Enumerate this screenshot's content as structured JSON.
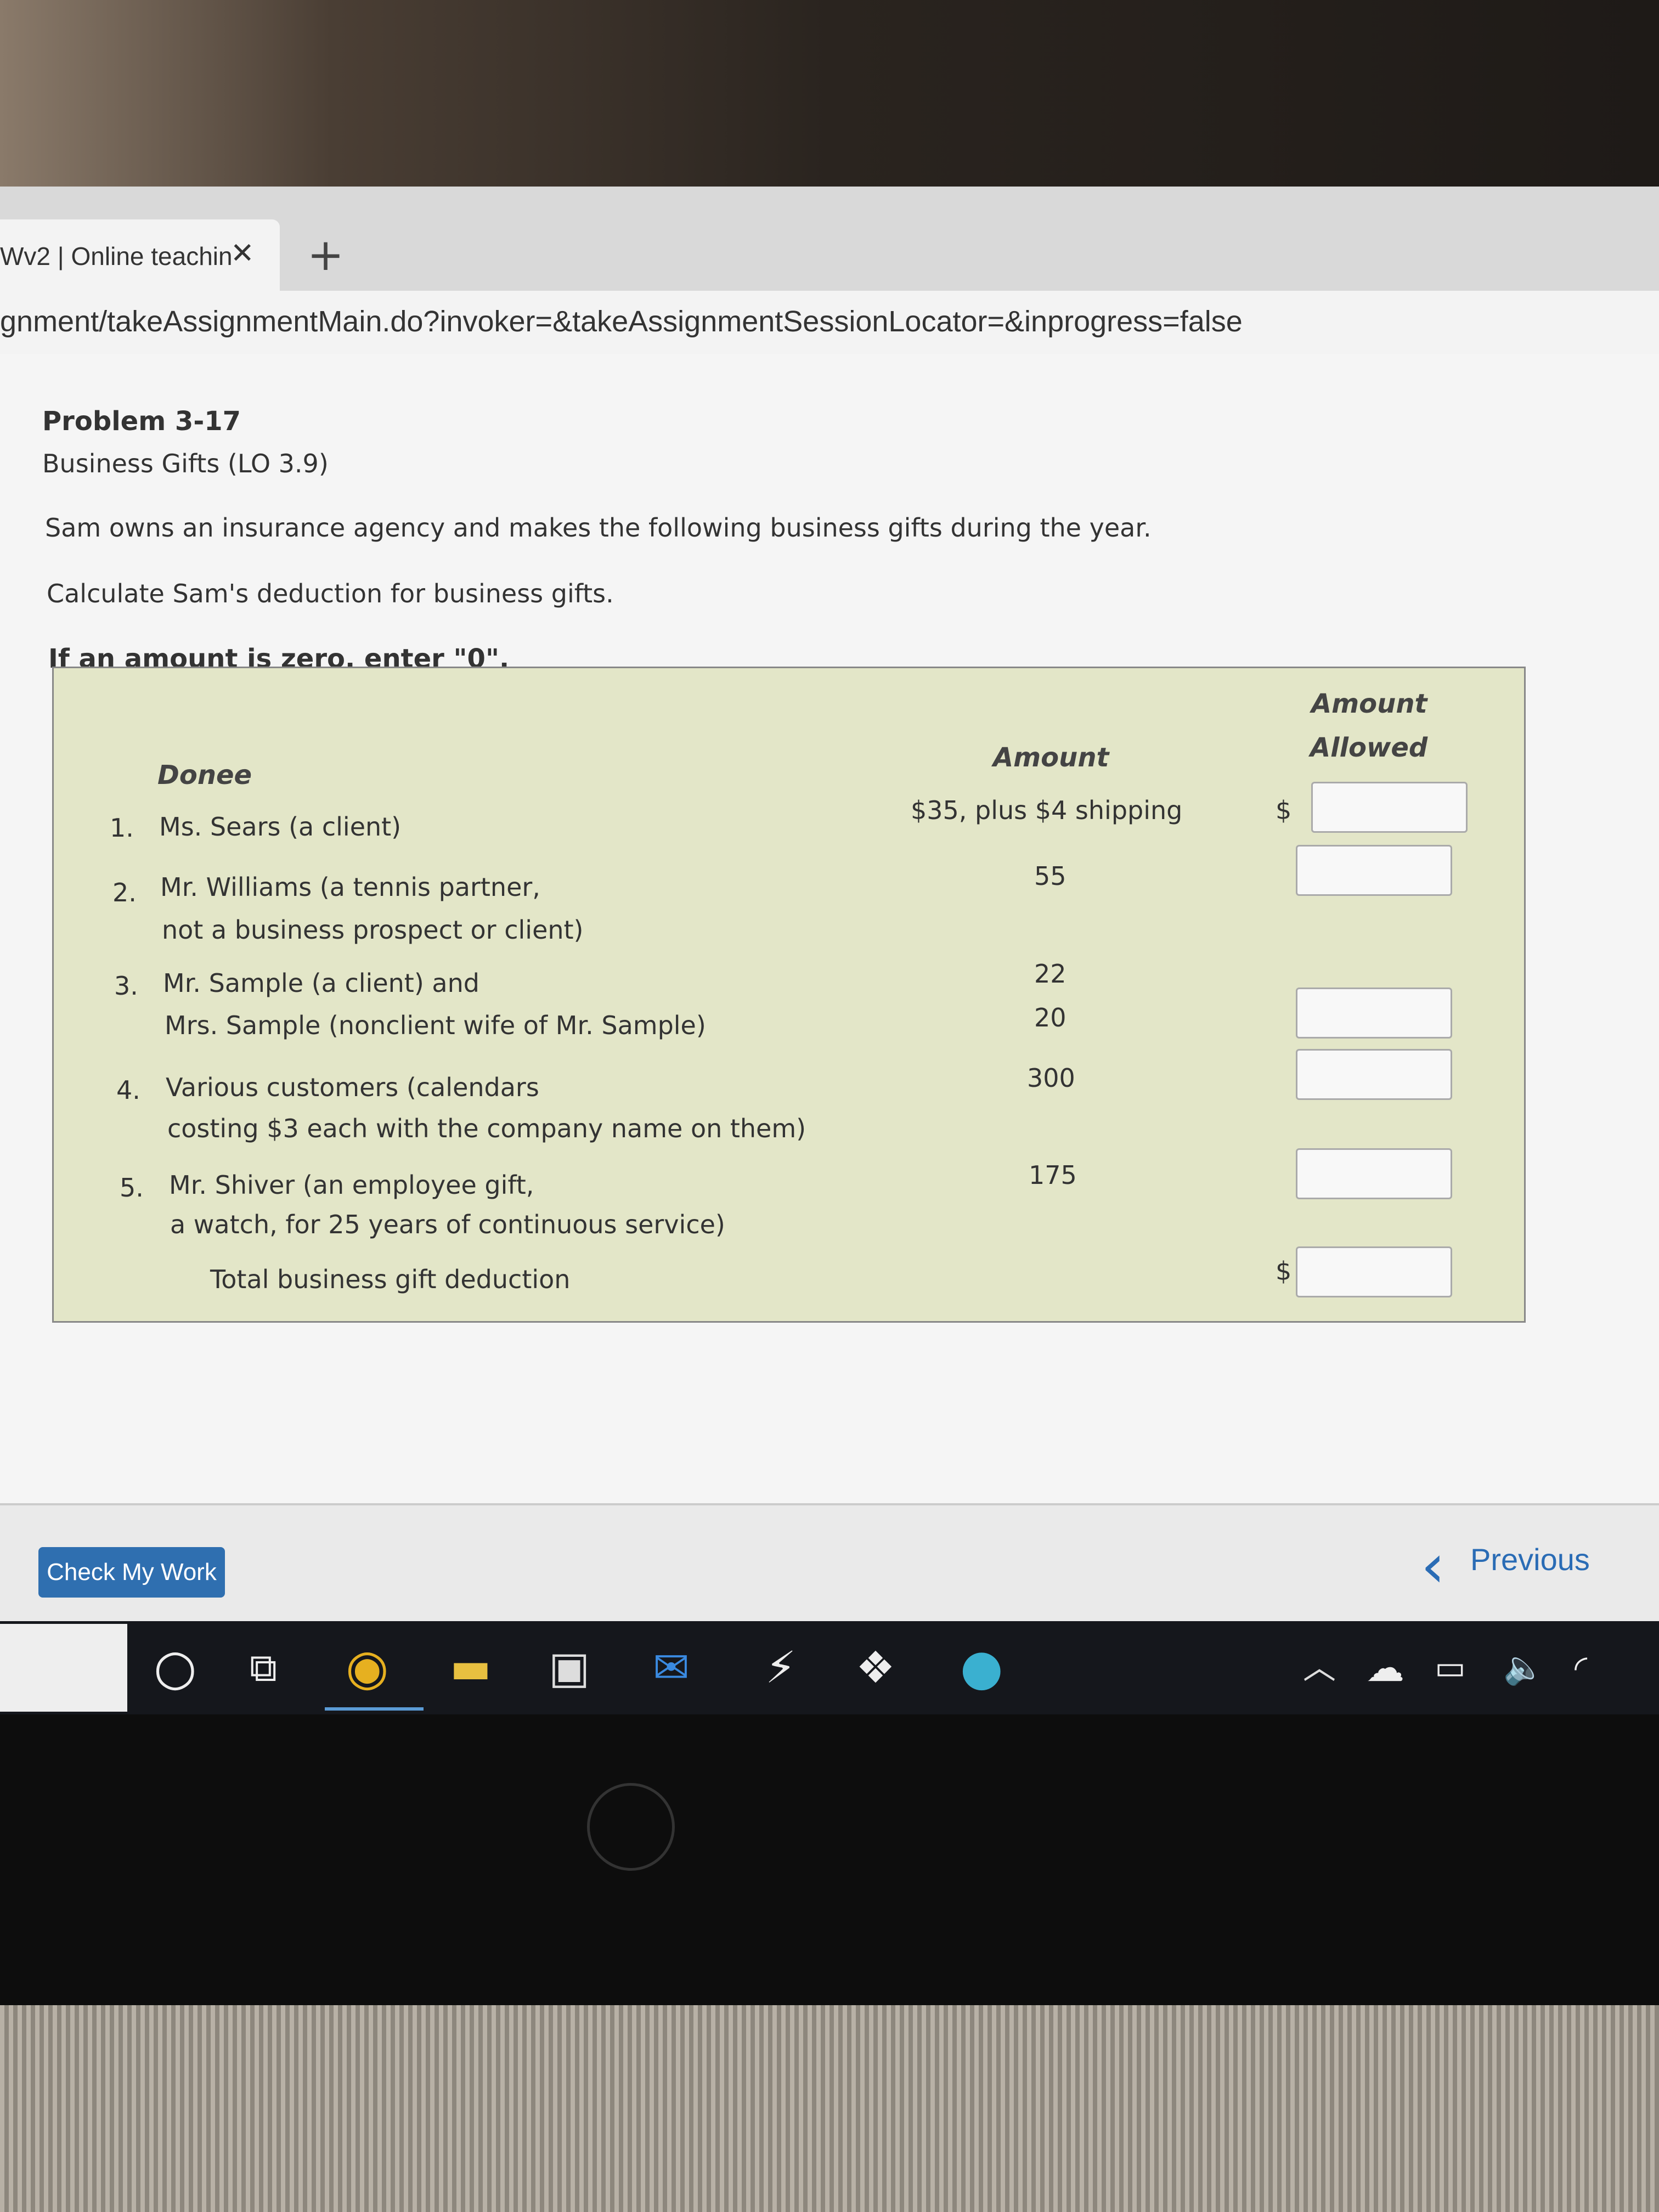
{
  "browser": {
    "tab_title": "Wv2 | Online teachin",
    "tab_close": "✕",
    "new_tab": "+",
    "url": "gnment/takeAssignmentMain.do?invoker=&takeAssignmentSessionLocator=&inprogress=false"
  },
  "problem": {
    "title": "Problem 3-17",
    "subtitle": "Business Gifts (LO 3.9)",
    "intro": "Sam owns an insurance agency and makes the following business gifts during the year.",
    "task": "Calculate Sam's deduction for business gifts.",
    "note": "If an amount is zero, enter \"0\"."
  },
  "table": {
    "headers": {
      "donee": "Donee",
      "amount": "Amount",
      "allowed_1": "Amount",
      "allowed_2": "Allowed"
    },
    "rows": [
      {
        "num": "1.",
        "line1": "Ms. Sears (a client)",
        "line2": "",
        "amount1": "$35, plus $4 shipping",
        "amount2": "",
        "value1": "",
        "value2": ""
      },
      {
        "num": "2.",
        "line1": "Mr. Williams (a tennis partner,",
        "line2": "not a business prospect or client)",
        "amount1": "55",
        "amount2": "",
        "value1": "",
        "value2": ""
      },
      {
        "num": "3.",
        "line1": "Mr. Sample (a client) and",
        "line2": "Mrs. Sample (nonclient wife of Mr. Sample)",
        "amount1": "22",
        "amount2": "20",
        "value1": "",
        "value2": ""
      },
      {
        "num": "4.",
        "line1": "Various customers (calendars",
        "line2": "costing $3 each with the company name on them)",
        "amount1": "300",
        "amount2": "",
        "value1": "",
        "value2": ""
      },
      {
        "num": "5.",
        "line1": "Mr. Shiver (an employee gift,",
        "line2": "a watch, for 25 years of continuous service)",
        "amount1": "175",
        "amount2": "",
        "value1": "",
        "value2": ""
      }
    ],
    "total_label": "Total business gift deduction",
    "currency": "$",
    "total_value": ""
  },
  "footer": {
    "check_label": "Check My Work",
    "previous_label": "Previous"
  },
  "taskbar": {
    "icons": [
      "cortana-icon",
      "task-view-icon",
      "chrome-icon",
      "file-explorer-icon",
      "store-icon",
      "mail-icon",
      "app-icon",
      "dropbox-icon",
      "edge-icon",
      "chevron-up-icon",
      "onedrive-icon",
      "battery-icon",
      "volume-icon",
      "wifi-icon"
    ]
  },
  "brand": {
    "logo": "hp"
  }
}
